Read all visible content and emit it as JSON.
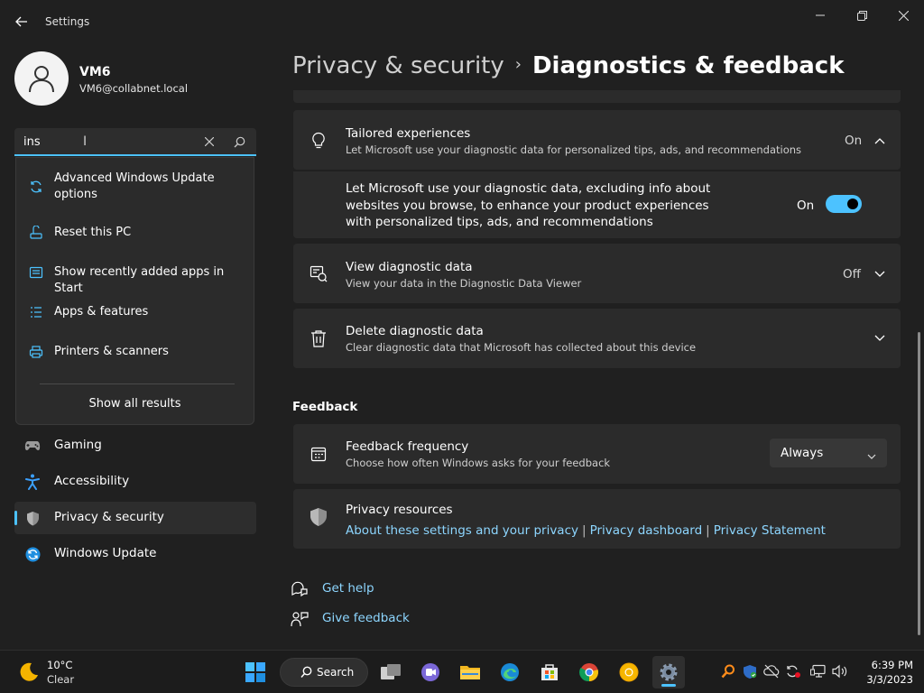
{
  "window": {
    "title": "Settings"
  },
  "account": {
    "name": "VM6",
    "email": "VM6@collabnet.local"
  },
  "search": {
    "value": "ins",
    "results": [
      {
        "label": "Advanced Windows Update options",
        "icon": "sync-icon"
      },
      {
        "label": "Reset this PC",
        "icon": "reset-pc-icon"
      },
      {
        "label": "Show recently added apps in Start",
        "icon": "start-apps-icon"
      },
      {
        "label": "Apps & features",
        "icon": "apps-list-icon"
      },
      {
        "label": "Printers & scanners",
        "icon": "printer-icon"
      }
    ],
    "show_all": "Show all results"
  },
  "nav": [
    {
      "label": "Gaming",
      "icon": "gamepad-icon"
    },
    {
      "label": "Accessibility",
      "icon": "accessibility-icon"
    },
    {
      "label": "Privacy & security",
      "icon": "shield-icon",
      "active": true
    },
    {
      "label": "Windows Update",
      "icon": "windows-update-icon"
    }
  ],
  "header": {
    "parent": "Privacy & security",
    "separator": "›",
    "current": "Diagnostics & feedback"
  },
  "tailored": {
    "title": "Tailored experiences",
    "desc": "Let Microsoft use your diagnostic data for personalized tips, ads, and recommendations",
    "state": "On",
    "detail": "Let Microsoft use your diagnostic data, excluding info about websites you browse, to enhance your product experiences with personalized tips, ads, and recommendations",
    "toggle_label": "On",
    "toggle_on": true
  },
  "view_data": {
    "title": "View diagnostic data",
    "desc": "View your data in the Diagnostic Data Viewer",
    "state": "Off"
  },
  "delete_data": {
    "title": "Delete diagnostic data",
    "desc": "Clear diagnostic data that Microsoft has collected about this device"
  },
  "feedback": {
    "section_title": "Feedback",
    "frequency_title": "Feedback frequency",
    "frequency_desc": "Choose how often Windows asks for your feedback",
    "frequency_value": "Always"
  },
  "privacy_resources": {
    "title": "Privacy resources",
    "links": [
      "About these settings and your privacy",
      "Privacy dashboard",
      "Privacy Statement"
    ],
    "link_separator": "|"
  },
  "help": {
    "get_help": "Get help",
    "give_feedback": "Give feedback"
  },
  "taskbar": {
    "weather_temp": "10°C",
    "weather_desc": "Clear",
    "search_label": "Search",
    "time": "6:39 PM",
    "date": "3/3/2023"
  },
  "colors": {
    "accent": "#4cc2ff",
    "link": "#8dd6ff",
    "card": "#2b2b2b",
    "background": "#202020"
  }
}
